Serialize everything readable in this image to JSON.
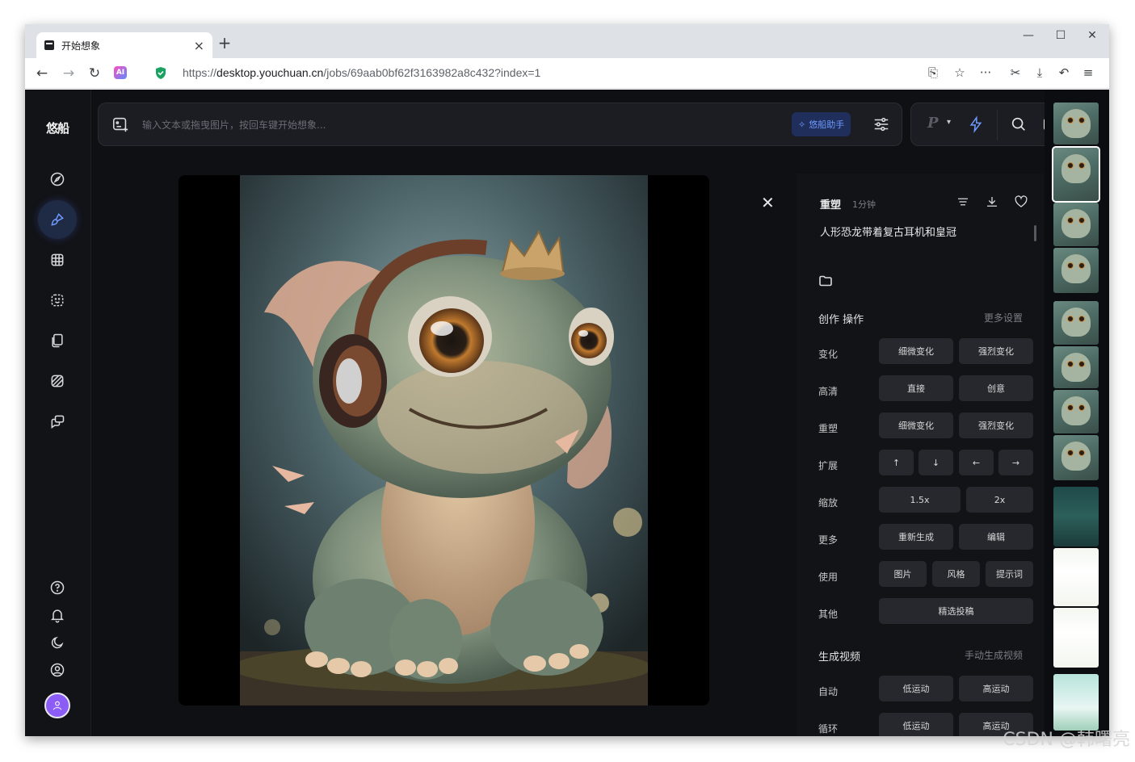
{
  "browser": {
    "tab_title": "开始想象",
    "url_prefix": "https://",
    "url_host": "desktop.youchuan.cn",
    "url_path": "/jobs/69aab0bf62f3163982a8c432?index=1",
    "ai_badge": "AI"
  },
  "app": {
    "logo": "悠船",
    "prompt_placeholder": "输入文本或拖曳图片，按回车键开始想象...",
    "assistant_label": "悠船助手",
    "mode_letter": "P"
  },
  "detail": {
    "title": "重塑",
    "time": "1分钟",
    "prompt": "人形恐龙带着复古耳机和皇冠",
    "section_create": "创作 操作",
    "more_settings": "更多设置",
    "rows": [
      {
        "label": "变化",
        "buttons": [
          "细微变化",
          "强烈变化"
        ]
      },
      {
        "label": "高清",
        "buttons": [
          "直接",
          "创意"
        ]
      },
      {
        "label": "重塑",
        "buttons": [
          "细微变化",
          "强烈变化"
        ]
      },
      {
        "label": "扩展",
        "buttons": [
          "↑",
          "↓",
          "←",
          "→"
        ]
      },
      {
        "label": "缩放",
        "buttons": [
          "1.5x",
          "2x"
        ]
      },
      {
        "label": "更多",
        "buttons": [
          "重新生成",
          "编辑"
        ]
      },
      {
        "label": "使用",
        "buttons": [
          "图片",
          "风格",
          "提示词"
        ]
      },
      {
        "label": "其他",
        "buttons": [
          "精选投稿"
        ]
      }
    ],
    "section_video": "生成视频",
    "manual_video": "手动生成视频",
    "video_rows": [
      {
        "label": "自动",
        "buttons": [
          "低运动",
          "高运动"
        ]
      },
      {
        "label": "循环",
        "buttons": [
          "低运动",
          "高运动"
        ]
      }
    ]
  },
  "watermark": "CSDN @韩曙亮"
}
